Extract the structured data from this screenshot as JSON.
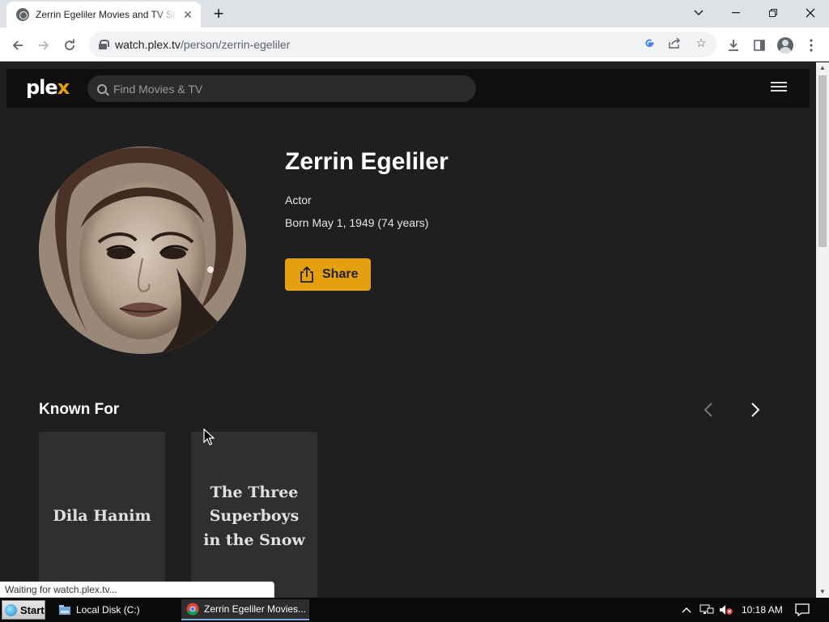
{
  "browser": {
    "tab_title": "Zerrin Egeliler Movies and TV Shows",
    "url_host": "watch.plex.tv",
    "url_path": "/person/zerrin-egeliler",
    "status_text": "Waiting for watch.plex.tv..."
  },
  "plex": {
    "logo_main": "ple",
    "logo_accent": "x",
    "search_placeholder": "Find Movies & TV"
  },
  "person": {
    "name": "Zerrin Egeliler",
    "role": "Actor",
    "born": "Born May 1, 1949 (74 years)",
    "share_label": "Share"
  },
  "known_for": {
    "title": "Known For",
    "items": [
      {
        "title": "Dila Hanim"
      },
      {
        "title": "The Three Superboys in the Snow"
      }
    ]
  },
  "taskbar": {
    "start_label": "Start",
    "items": [
      {
        "label": "Local Disk (C:)"
      },
      {
        "label": "Zerrin Egeliler Movies..."
      }
    ],
    "clock": "10:18 AM"
  },
  "colors": {
    "plex_accent": "#e5a00d",
    "page_bg": "#1f1f1f"
  },
  "icons": [
    "globe-icon",
    "close-icon",
    "plus-icon",
    "back-icon",
    "forward-icon",
    "reload-icon",
    "lock-icon",
    "google-icon",
    "share-page-icon",
    "star-icon",
    "download-icon",
    "sidepanel-icon",
    "profile-icon",
    "kebab-menu-icon",
    "search-icon",
    "hamburger-icon",
    "share-icon",
    "chevron-left-icon",
    "chevron-right-icon",
    "folder-icon",
    "chrome-icon"
  ]
}
